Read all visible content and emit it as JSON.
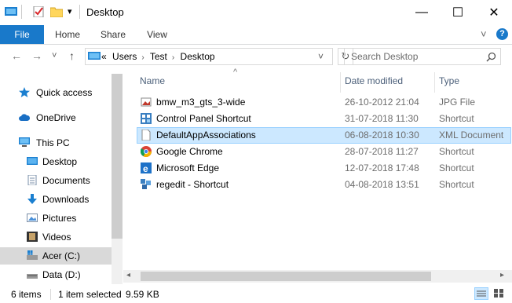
{
  "window": {
    "title": "Desktop",
    "minimize_glyph": "—",
    "maximize_glyph": "☐",
    "close_glyph": "✕",
    "qa_dropdown_glyph": "▾"
  },
  "ribbon": {
    "tabs": [
      "File",
      "Home",
      "Share",
      "View"
    ],
    "collapse_glyph": "˅",
    "help_glyph": "?"
  },
  "navigation": {
    "back_glyph": "←",
    "forward_glyph": "→",
    "recent_glyph": "˅",
    "up_glyph": "↑"
  },
  "address": {
    "overflow": "«",
    "crumbs": [
      "Users",
      "Test",
      "Desktop"
    ],
    "separator": "›",
    "dropdown_glyph": "˅",
    "refresh_glyph": "↻"
  },
  "search": {
    "placeholder": "Search Desktop",
    "icon": "search-icon"
  },
  "nav_pane": {
    "items": [
      {
        "label": "Quick access",
        "icon": "star-icon"
      },
      {
        "label": "OneDrive",
        "icon": "cloud-icon"
      },
      {
        "label": "This PC",
        "icon": "computer-icon"
      },
      {
        "label": "Desktop",
        "icon": "desktop-folder-icon"
      },
      {
        "label": "Documents",
        "icon": "documents-icon"
      },
      {
        "label": "Downloads",
        "icon": "downloads-icon"
      },
      {
        "label": "Pictures",
        "icon": "pictures-icon"
      },
      {
        "label": "Videos",
        "icon": "videos-icon"
      },
      {
        "label": "Acer (C:)",
        "icon": "drive-c-icon"
      },
      {
        "label": "Data (D:)",
        "icon": "drive-d-icon"
      }
    ],
    "selected": "Acer (C:)"
  },
  "files": {
    "columns": {
      "name": "Name",
      "date": "Date modified",
      "type": "Type"
    },
    "sort_glyph": "^",
    "rows": [
      {
        "name": "bmw_m3_gts_3-wide",
        "date": "26-10-2012 21:04",
        "type": "JPG File",
        "icon": "image-file-icon"
      },
      {
        "name": "Control Panel Shortcut",
        "date": "31-07-2018 11:30",
        "type": "Shortcut",
        "icon": "control-panel-icon"
      },
      {
        "name": "DefaultAppAssociations",
        "date": "06-08-2018 10:30",
        "type": "XML Document",
        "icon": "xml-file-icon",
        "selected": true
      },
      {
        "name": "Google Chrome",
        "date": "28-07-2018 11:27",
        "type": "Shortcut",
        "icon": "chrome-icon"
      },
      {
        "name": "Microsoft Edge",
        "date": "12-07-2018 17:48",
        "type": "Shortcut",
        "icon": "edge-icon"
      },
      {
        "name": "regedit - Shortcut",
        "date": "04-08-2018 13:51",
        "type": "Shortcut",
        "icon": "regedit-icon"
      }
    ]
  },
  "status": {
    "item_count": "6 items",
    "selection": "1 item selected",
    "size": "9.59 KB"
  },
  "colors": {
    "accent": "#1979ca",
    "selection_bg": "#cce8ff",
    "selection_border": "#99d1ff",
    "header_text": "#4c607a"
  }
}
